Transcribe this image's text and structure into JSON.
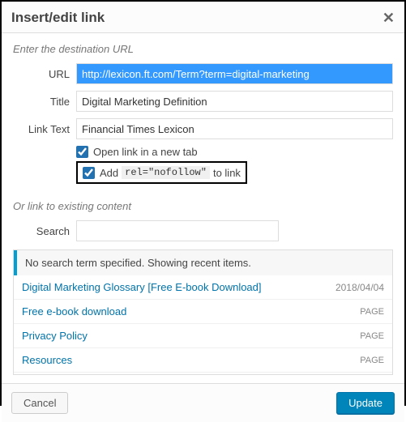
{
  "dialog": {
    "title": "Insert/edit link",
    "close_icon": "✕"
  },
  "section_url_label": "Enter the destination URL",
  "fields": {
    "url_label": "URL",
    "url_value": "http://lexicon.ft.com/Term?term=digital-marketing",
    "title_label": "Title",
    "title_value": "Digital Marketing Definition",
    "linktext_label": "Link Text",
    "linktext_value": "Financial Times Lexicon"
  },
  "checks": {
    "newtab_label": "Open link in a new tab",
    "nofollow_prefix": "Add",
    "nofollow_code": "rel=\"nofollow\"",
    "nofollow_suffix": "to link"
  },
  "section_existing_label": "Or link to existing content",
  "search_label": "Search",
  "search_value": "",
  "results_message": "No search term specified. Showing recent items.",
  "results": [
    {
      "title": "Digital Marketing Glossary [Free E-book Download]",
      "meta": "2018/04/04",
      "meta_type": "date"
    },
    {
      "title": "Free e-book download",
      "meta": "PAGE",
      "meta_type": "page"
    },
    {
      "title": "Privacy Policy",
      "meta": "PAGE",
      "meta_type": "page"
    },
    {
      "title": "Resources",
      "meta": "PAGE",
      "meta_type": "page"
    }
  ],
  "footer": {
    "cancel": "Cancel",
    "update": "Update"
  }
}
